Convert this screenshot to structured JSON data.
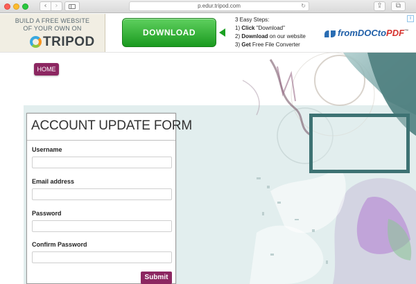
{
  "browser": {
    "url": "p.edur.tripod.com",
    "back_glyph": "‹",
    "forward_glyph": "›",
    "reload_glyph": "↻",
    "share_glyph": "⇪",
    "tabs_glyph": "⧉",
    "icons": [
      "back-icon",
      "forward-icon",
      "sidebar-icon",
      "reload-icon",
      "share-icon",
      "tabs-icon"
    ]
  },
  "ad": {
    "tripod_line1": "BUILD A FREE WEBSITE",
    "tripod_line2": "OF YOUR OWN ON",
    "tripod_logo": "TRIPOD",
    "download_label": "DOWNLOAD",
    "steps": {
      "heading": "3 Easy Steps:",
      "step1_prefix": "1) ",
      "step1_bold": "Click",
      "step1_rest": " \"Download\"",
      "step2_prefix": "2) ",
      "step2_bold": "Download",
      "step2_rest": " on our website",
      "step3_prefix": "3) ",
      "step3_bold": "Get",
      "step3_rest": " Free File Converter"
    },
    "brand_part1": "fromDOCto",
    "brand_part2": "PDF",
    "brand_tm": "™",
    "adchoices_glyph": "i",
    "colors": {
      "download_green": "#1a9a1f",
      "tripod_blue": "#39a9e0"
    }
  },
  "nav": {
    "home_label": "HOME"
  },
  "form": {
    "title": "ACCOUNT UPDATE FORM",
    "username_label": "Username",
    "username_value": "",
    "email_label": "Email address",
    "email_value": "",
    "password_label": "Password",
    "password_value": "",
    "confirm_label": "Confirm Password",
    "confirm_value": "",
    "submit_label": "Submit"
  },
  "colors": {
    "accent": "#8c2761",
    "panel": "#e2eeee",
    "frame": "#3d7273"
  }
}
